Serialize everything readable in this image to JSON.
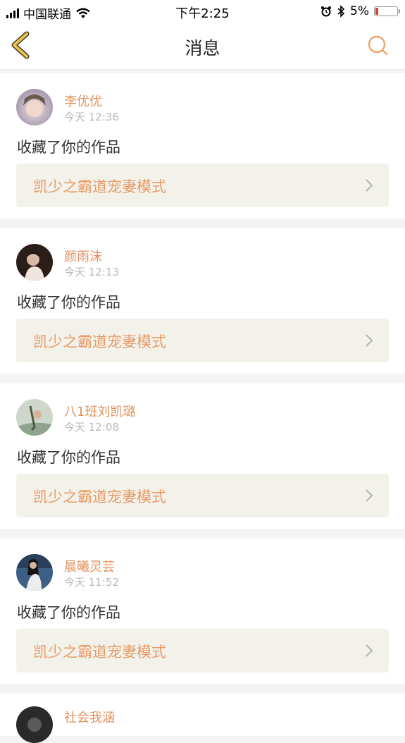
{
  "status_bar": {
    "carrier": "中国联通",
    "time": "下午2:25",
    "battery": "5%"
  },
  "nav": {
    "title": "消息"
  },
  "colors": {
    "accent": "#e2915c",
    "card_link_bg": "#f3f2ea",
    "battery_low": "#e23b3b"
  },
  "messages": [
    {
      "username": "李优优",
      "time": "今天 12:36",
      "action": "收藏了你的作品",
      "work_title": "凯少之霸道宠妻模式"
    },
    {
      "username": "颜雨沫",
      "time": "今天 12:13",
      "action": "收藏了你的作品",
      "work_title": "凯少之霸道宠妻模式"
    },
    {
      "username": "八1班刘凯璐",
      "time": "今天 12:08",
      "action": "收藏了你的作品",
      "work_title": "凯少之霸道宠妻模式"
    },
    {
      "username": "晨曦灵芸",
      "time": "今天 11:52",
      "action": "收藏了你的作品",
      "work_title": "凯少之霸道宠妻模式"
    },
    {
      "username": "社会我涵"
    }
  ]
}
